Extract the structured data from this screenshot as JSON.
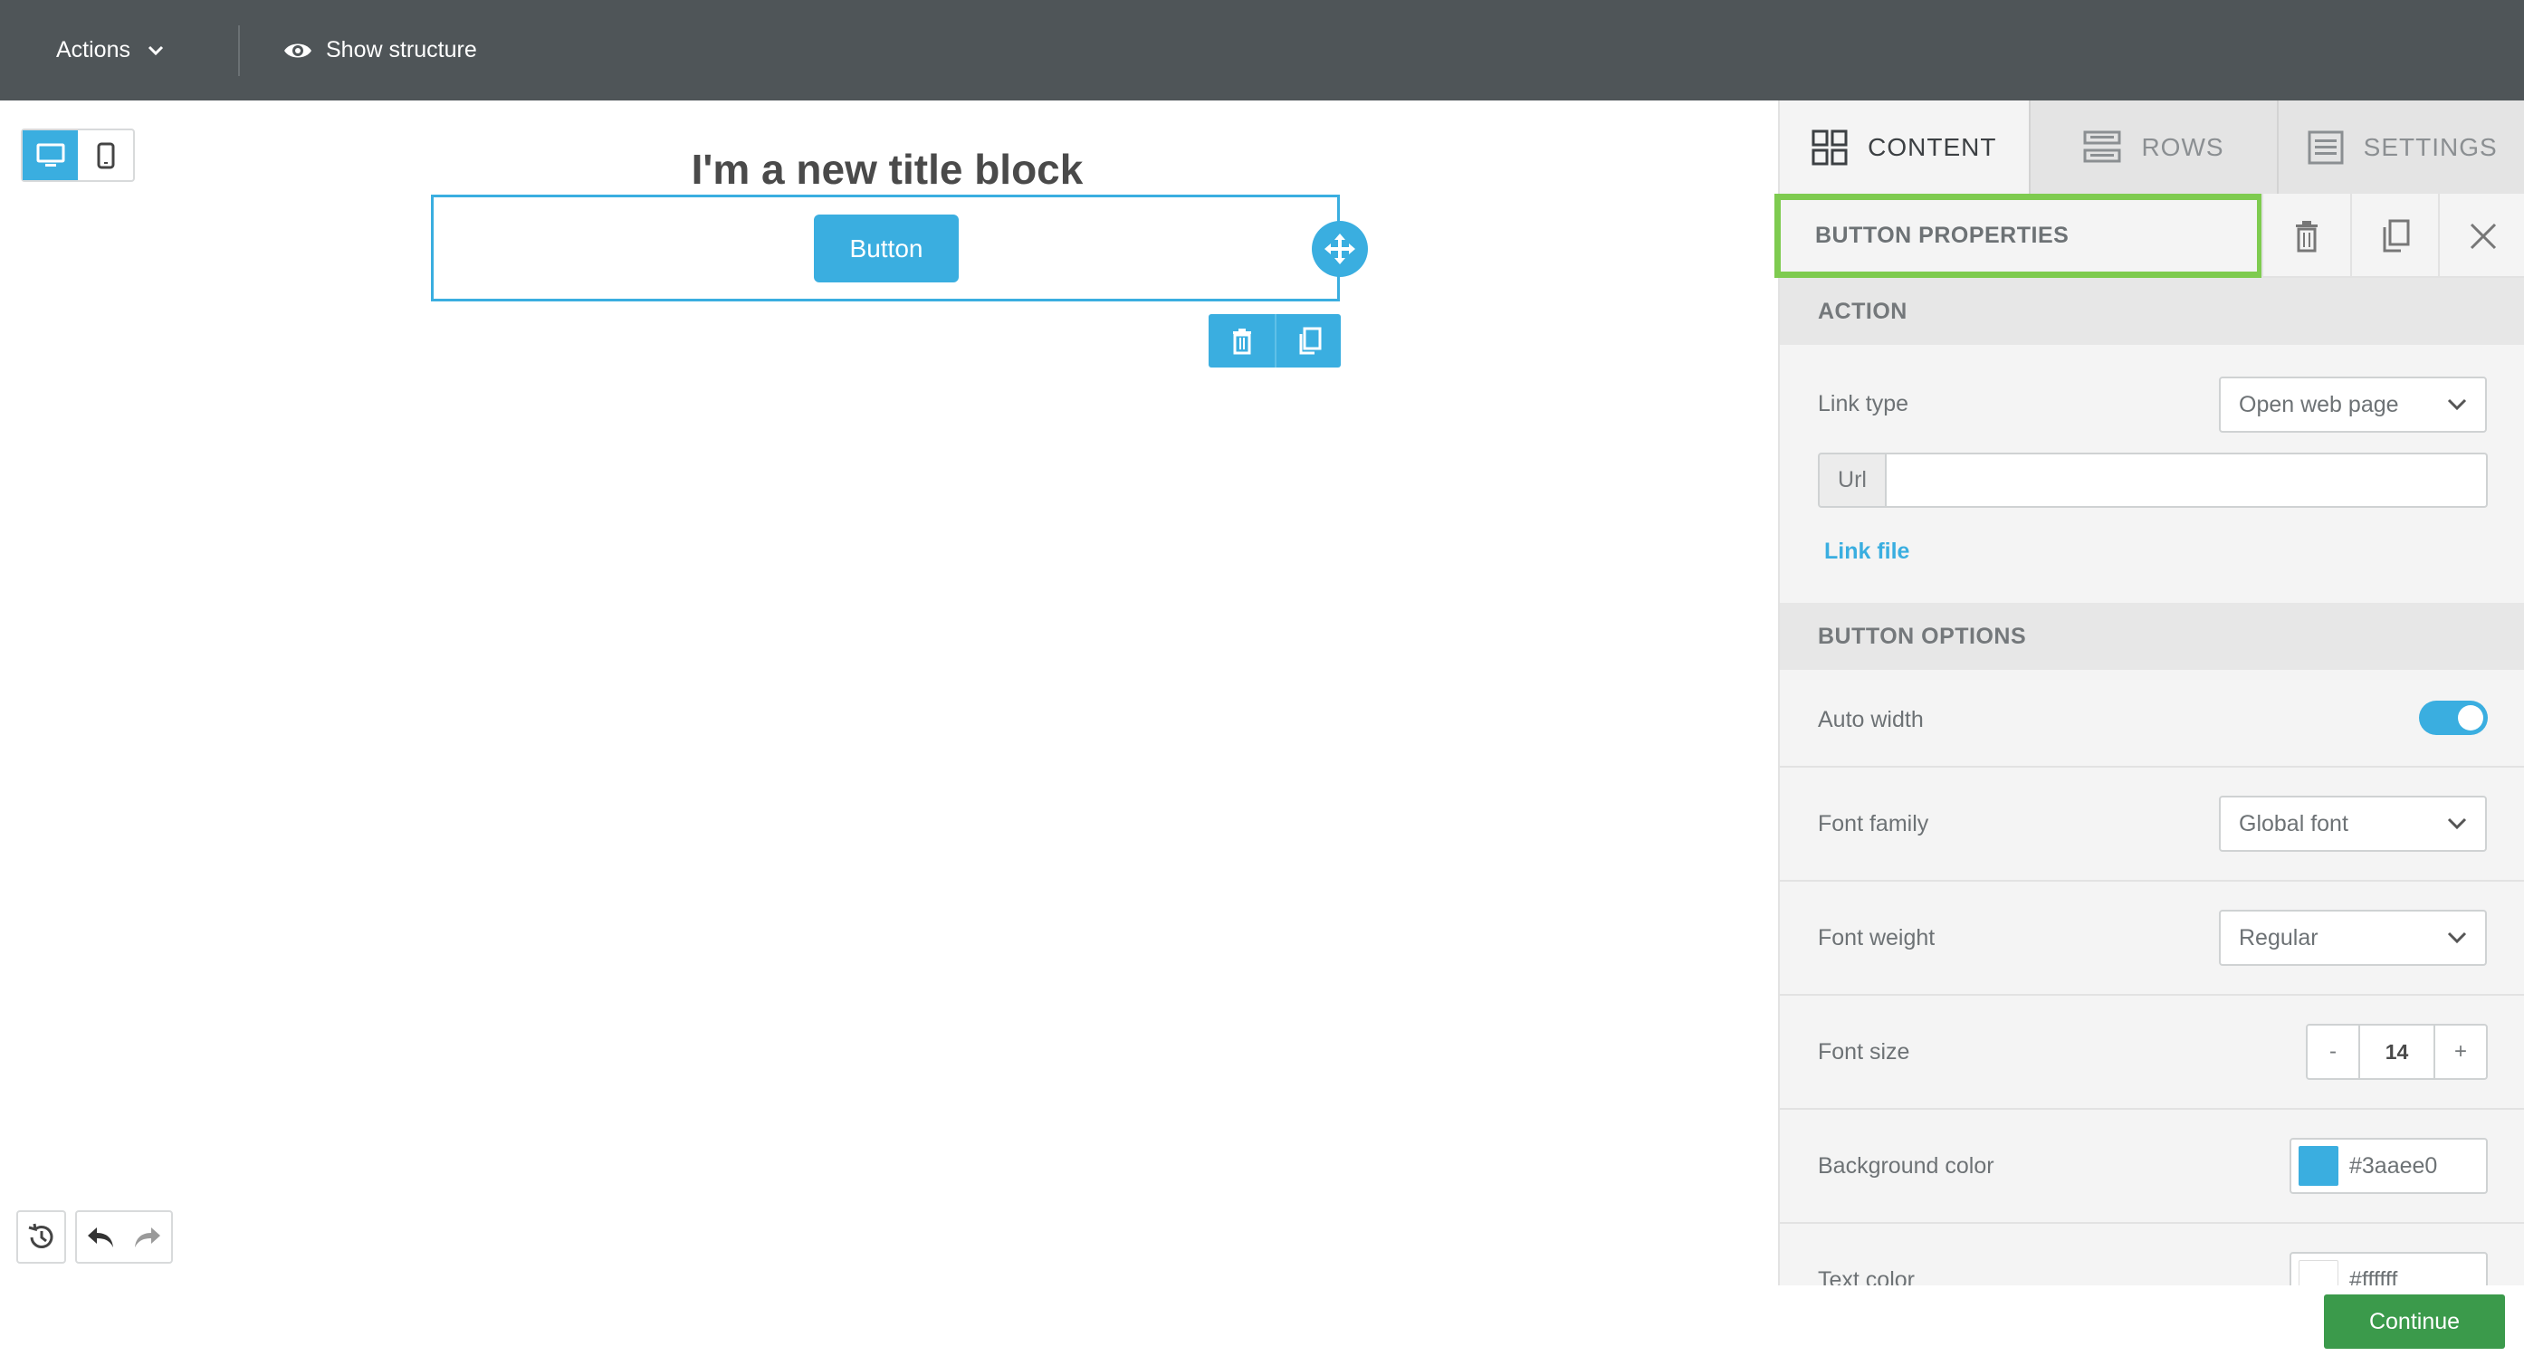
{
  "topbar": {
    "actions_label": "Actions",
    "show_structure_label": "Show structure"
  },
  "canvas": {
    "title": "I'm a new title block",
    "button_label": "Button"
  },
  "panel": {
    "tabs": [
      {
        "label": "CONTENT",
        "icon": "grid-icon",
        "active": true
      },
      {
        "label": "ROWS",
        "icon": "rows-icon",
        "active": false
      },
      {
        "label": "SETTINGS",
        "icon": "settings-list-icon",
        "active": false
      }
    ],
    "properties_title": "BUTTON PROPERTIES",
    "action": {
      "heading": "ACTION",
      "link_type_label": "Link type",
      "link_type_value": "Open web page",
      "url_prefix": "Url",
      "url_value": "",
      "link_file_label": "Link file"
    },
    "options": {
      "heading": "BUTTON OPTIONS",
      "auto_width_label": "Auto width",
      "auto_width_on": true,
      "font_family_label": "Font family",
      "font_family_value": "Global font",
      "font_weight_label": "Font weight",
      "font_weight_value": "Regular",
      "font_size_label": "Font size",
      "font_size_minus": "-",
      "font_size_value": "14",
      "font_size_plus": "+",
      "background_color_label": "Background color",
      "background_color_value": "#3aaee0",
      "text_color_label": "Text color",
      "text_color_value": "#ffffff"
    }
  },
  "footer": {
    "continue_label": "Continue"
  },
  "colors": {
    "accent": "#3aaee0",
    "highlight": "#7ecb4f",
    "continue": "#3b9a4b"
  }
}
